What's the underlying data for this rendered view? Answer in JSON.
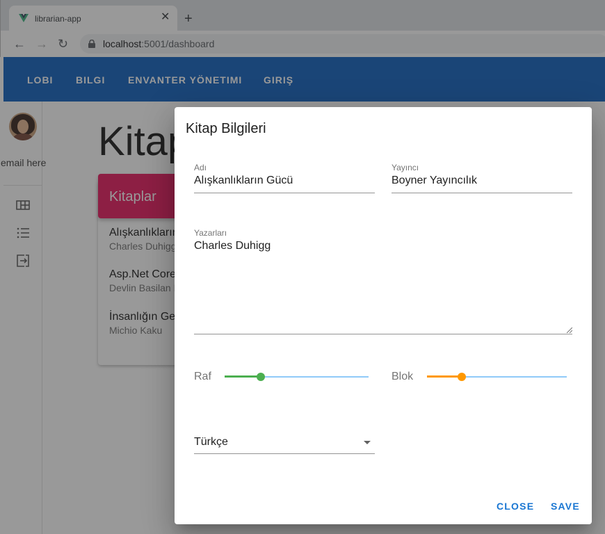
{
  "browser": {
    "tab_title": "librarian-app",
    "close_glyph": "✕",
    "new_tab_glyph": "+",
    "back_glyph": "←",
    "forward_glyph": "→",
    "reload_glyph": "↻",
    "url_host": "localhost",
    "url_rest": ":5001/dashboard"
  },
  "appbar": {
    "links": [
      "LOBI",
      "BILGI",
      "ENVANTER YÖNETIMI",
      "GIRIŞ"
    ],
    "color": "#1565c0"
  },
  "drawer": {
    "email": "email here",
    "icons": [
      "dashboard-icon",
      "list-icon",
      "logout-icon"
    ]
  },
  "page": {
    "title": "Kitap",
    "card_title": "Kitaplar",
    "card_color": "#e91e63",
    "books": [
      {
        "title": "Alışkanlıkların",
        "author": "Charles Duhigg"
      },
      {
        "title": "Asp.Net Core",
        "author": "Devlin Basilan D"
      },
      {
        "title": "İnsanlığın Ge",
        "author": "Michio Kaku"
      }
    ]
  },
  "dialog": {
    "title": "Kitap Bilgileri",
    "name_label": "Adı",
    "name_value": "Alışkanlıkların Gücü",
    "publisher_label": "Yayıncı",
    "publisher_value": "Boyner Yayıncılık",
    "authors_label": "Yazarları",
    "authors_value": "Charles Duhigg",
    "shelf_label": "Raf",
    "shelf_level": 0.25,
    "shelf_color": "#4caf50",
    "block_label": "Blok",
    "block_level": 0.25,
    "block_color": "#ff9800",
    "language_value": "Türkçe",
    "close_label": "CLOSE",
    "save_label": "SAVE"
  }
}
